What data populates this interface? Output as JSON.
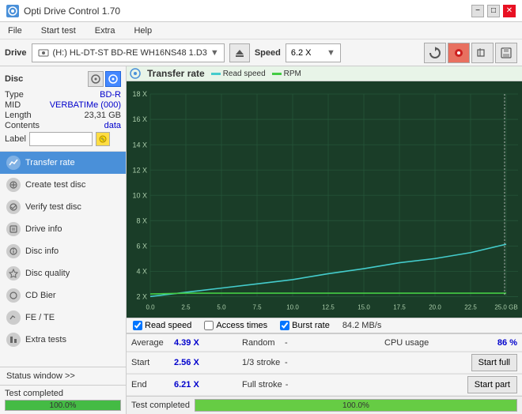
{
  "app": {
    "title": "Opti Drive Control 1.70",
    "title_icon": "disc"
  },
  "title_controls": {
    "minimize": "−",
    "maximize": "□",
    "close": "✕"
  },
  "menu": {
    "items": [
      "File",
      "Start test",
      "Extra",
      "Help"
    ]
  },
  "toolbar": {
    "drive_label": "Drive",
    "drive_name": "(H:)  HL-DT-ST BD-RE  WH16NS48 1.D3",
    "speed_label": "Speed",
    "speed_value": "6.2 X"
  },
  "disc": {
    "section_title": "Disc",
    "type_label": "Type",
    "type_value": "BD-R",
    "mid_label": "MID",
    "mid_value": "VERBATIMe (000)",
    "length_label": "Length",
    "length_value": "23,31 GB",
    "contents_label": "Contents",
    "contents_value": "data",
    "label_label": "Label"
  },
  "nav": {
    "items": [
      {
        "id": "transfer-rate",
        "label": "Transfer rate",
        "active": true
      },
      {
        "id": "create-test-disc",
        "label": "Create test disc",
        "active": false
      },
      {
        "id": "verify-test-disc",
        "label": "Verify test disc",
        "active": false
      },
      {
        "id": "drive-info",
        "label": "Drive info",
        "active": false
      },
      {
        "id": "disc-info",
        "label": "Disc info",
        "active": false
      },
      {
        "id": "disc-quality",
        "label": "Disc quality",
        "active": false
      },
      {
        "id": "cd-bier",
        "label": "CD Bier",
        "active": false
      },
      {
        "id": "fe-te",
        "label": "FE / TE",
        "active": false
      },
      {
        "id": "extra-tests",
        "label": "Extra tests",
        "active": false
      }
    ]
  },
  "status_window": {
    "label": "Status window  >>",
    "completed_text": "Test completed",
    "progress_value": "100.0%"
  },
  "chart": {
    "title": "Transfer rate",
    "legend": [
      {
        "id": "read-speed",
        "label": "Read speed",
        "color": "#44cccc"
      },
      {
        "id": "rpm",
        "label": "RPM",
        "color": "#44cc44"
      }
    ],
    "y_axis_labels": [
      "18 X",
      "16 X",
      "14 X",
      "12 X",
      "10 X",
      "8 X",
      "6 X",
      "4 X",
      "2 X"
    ],
    "x_axis_labels": [
      "0.0",
      "2.5",
      "5.0",
      "7.5",
      "10.0",
      "12.5",
      "15.0",
      "17.5",
      "20.0",
      "22.5",
      "25.0 GB"
    ]
  },
  "checkboxes": {
    "read_speed": {
      "label": "Read speed",
      "checked": true
    },
    "access_times": {
      "label": "Access times",
      "checked": false
    },
    "burst_rate": {
      "label": "Burst rate",
      "checked": true,
      "value": "84.2 MB/s"
    }
  },
  "stats": {
    "average_label": "Average",
    "average_value": "4.39 X",
    "random_label": "Random",
    "random_value": "-",
    "cpu_usage_label": "CPU usage",
    "cpu_usage_value": "86 %",
    "start_label": "Start",
    "start_value": "2.56 X",
    "stroke_1_3_label": "1/3 stroke",
    "stroke_1_3_value": "-",
    "start_full_label": "Start full",
    "end_label": "End",
    "end_value": "6.21 X",
    "full_stroke_label": "Full stroke",
    "full_stroke_value": "-",
    "start_part_label": "Start part"
  },
  "bottom": {
    "status_text": "Test completed",
    "progress_value": "100.0%"
  }
}
